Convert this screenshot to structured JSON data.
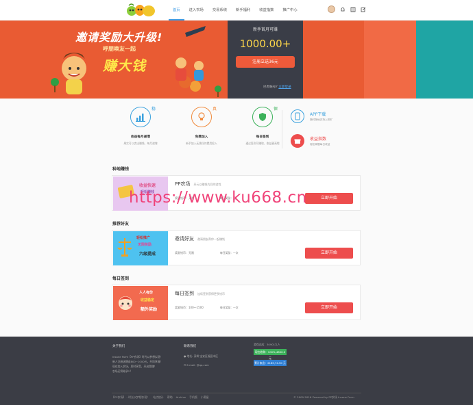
{
  "nav": {
    "items": [
      "首页",
      "进入农场",
      "交易系统",
      "新手福利",
      "收益指数",
      "推广中心"
    ]
  },
  "banner": {
    "title": "邀请奖励大升级!",
    "subtitle": "呼朋唤友一起",
    "big": "赚大钱"
  },
  "signup": {
    "title": "新手首月可赚",
    "amount": "1000.00+",
    "button": "注册立送36元",
    "login_prefix": "已有账号?",
    "login_link": "立即登录"
  },
  "features": [
    {
      "badge": "稳",
      "title": "收益每月递增",
      "desc": "果实可以卖出赚钱，每月递增"
    },
    {
      "badge": "真",
      "title": "免费加入",
      "desc": "新手加入无需任何费用投入"
    },
    {
      "badge": "保",
      "title": "每日签到",
      "desc": "通过签到可赚取，收益更高哦"
    }
  ],
  "side": [
    {
      "title": "APP下载",
      "desc": "随时随地农场上挖矿"
    },
    {
      "title": "收益指数",
      "desc": "轻松掌握每日收益"
    }
  ],
  "sections": [
    {
      "title": "种地赚钱",
      "img_lines": [
        "收益快速",
        "轻松赚钱"
      ],
      "name": "PP农场",
      "name_desc": "开元以赚钱为目的游戏",
      "meta": "奖励钱币：无限",
      "meta2": "每日奖励：无",
      "button": "立即开始"
    },
    {
      "title": "推荐好友",
      "img_lines": [
        "轻松推广",
        "无限奖励",
        "六级提成"
      ],
      "name": "邀请好友",
      "name_desc": "邀请朋友帮你一起赚钱",
      "meta": "奖励钱币：无限",
      "meta2": "每日奖励：一次",
      "button": "立即开始"
    },
    {
      "title": "每日签到",
      "img_lines": [
        "人人有份",
        "收益稳定",
        "额外奖励"
      ],
      "name": "每日签到",
      "name_desc": "连续签到获得更多钱币",
      "meta": "奖励钱币：100～1500",
      "meta2": "每日奖励：一次",
      "button": "立即开始"
    }
  ],
  "watermark": "https://www.ku668.cn",
  "footer": {
    "about_title": "关于我们",
    "about_lines": [
      "Insane Farm【PP农场】时光以梦想实现！",
      "新人注册送赠送800~1000元，共同享福！",
      "现在加入农场，愿时享受，开启我赚！",
      "农场还将继承1？"
    ],
    "contact_title": "联系我们",
    "contact_addr": "地址: 深圳·宝安区福田市区",
    "contact_mail": "E-mail: @qq.com",
    "stats_label": "游戏达成：",
    "stats_value": "30901九人",
    "green_btn": "现在收购：100%,4800.0 元",
    "blue_btn": "累计卖出：2185,74.50 元",
    "links": [
      "【PP农场】 - 时光以梦想实现！",
      "站点统计",
      "帮助",
      "Archive",
      "手机版",
      "小黑屋"
    ],
    "copyright": "© 2009-2016 Powered by PP农场 Insane Farm"
  }
}
